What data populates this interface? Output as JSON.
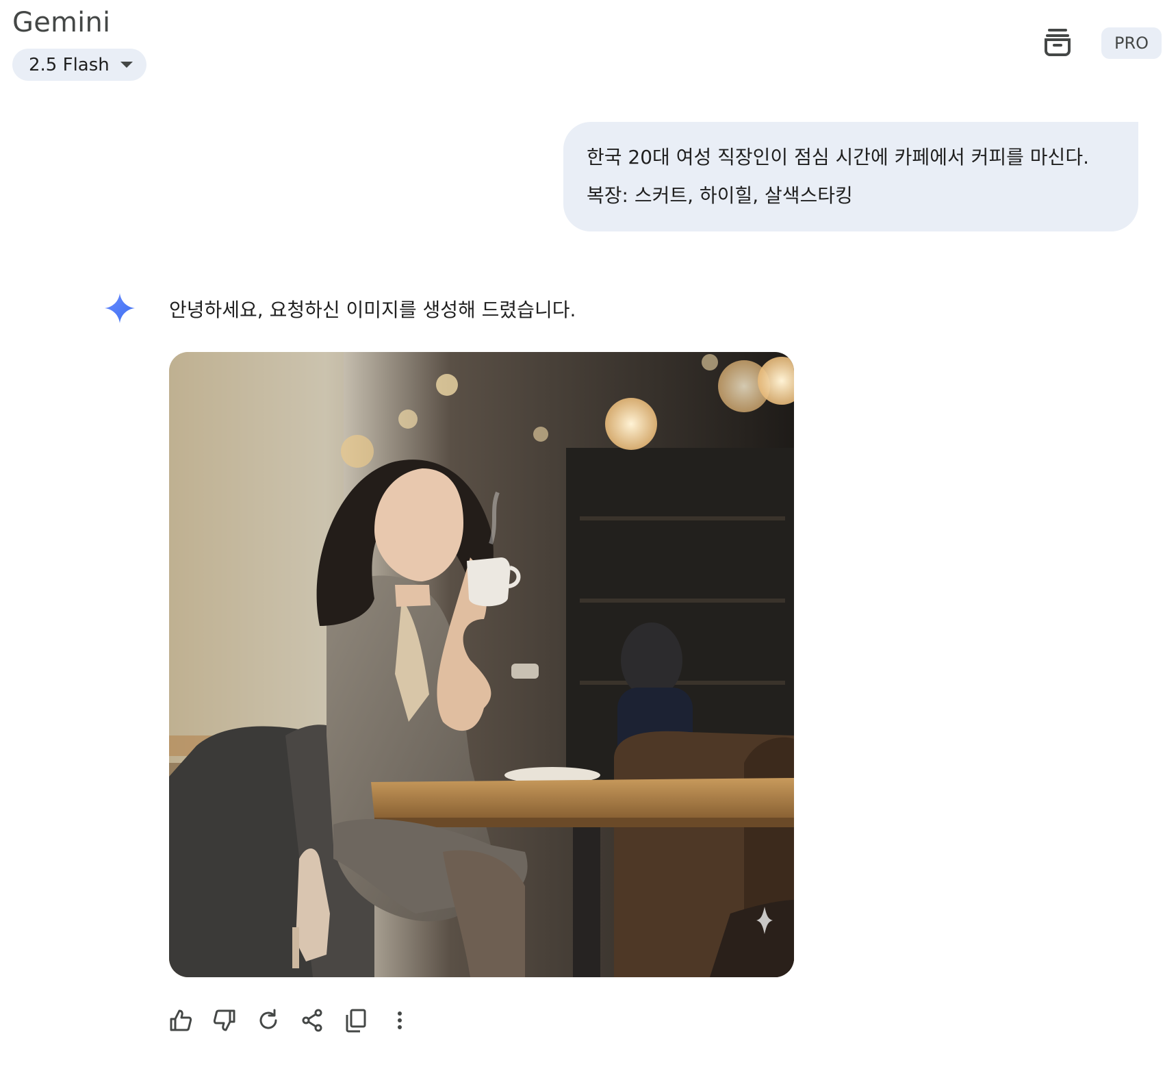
{
  "header": {
    "app_title": "Gemini",
    "model_label": "2.5 Flash",
    "pro_label": "PRO"
  },
  "user_message": {
    "line1": "한국 20대 여성 직장인이 점심 시간에 카페에서 커피를 마신다.",
    "line2": "복장: 스커트, 하이힐, 살색스타킹"
  },
  "response": {
    "text": "안녕하세요, 요청하신 이미지를 생성해 드렸습니다."
  },
  "icons": {
    "history": "history-icon",
    "spark": "gemini-spark-icon",
    "actions": [
      "thumbs-up-icon",
      "thumbs-down-icon",
      "regenerate-icon",
      "share-icon",
      "copy-icon",
      "more-icon"
    ]
  },
  "colors": {
    "accent_blue": "#4285f4",
    "chip_background": "#e9eef6",
    "text_primary": "#1f1f1f",
    "text_secondary": "#444746"
  }
}
